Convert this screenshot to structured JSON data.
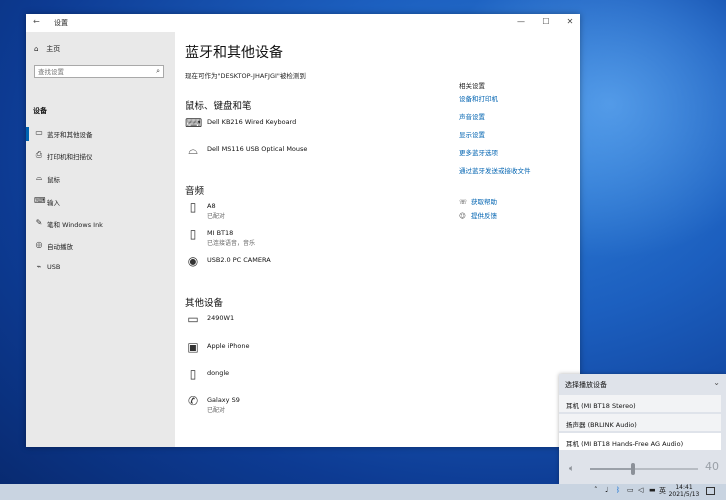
{
  "window": {
    "title": "设置",
    "back_glyph": "←",
    "minimize_glyph": "—",
    "maximize_glyph": "☐",
    "close_glyph": "✕"
  },
  "sidebar": {
    "home": "主页",
    "search_placeholder": "查找设置",
    "section": "设备",
    "items": [
      {
        "label": "蓝牙和其他设备",
        "icon": "bluetooth-devices-icon",
        "active": true
      },
      {
        "label": "打印机和扫描仪",
        "icon": "printer-icon"
      },
      {
        "label": "鼠标",
        "icon": "mouse-icon"
      },
      {
        "label": "输入",
        "icon": "keyboard-icon"
      },
      {
        "label": "笔和 Windows Ink",
        "icon": "pen-icon"
      },
      {
        "label": "自动播放",
        "icon": "autoplay-icon"
      },
      {
        "label": "USB",
        "icon": "usb-icon"
      }
    ]
  },
  "main": {
    "title": "蓝牙和其他设备",
    "discoverable": "现在可作为\"DESKTOP-JHAFJGI\"被检测到",
    "sections": [
      {
        "heading": "鼠标、键盘和笔",
        "devices": [
          {
            "name": "Dell KB216 Wired Keyboard",
            "status": "",
            "icon": "keyboard-icon"
          },
          {
            "name": "Dell MS116 USB Optical Mouse",
            "status": "",
            "icon": "mouse-icon"
          }
        ]
      },
      {
        "heading": "音频",
        "devices": [
          {
            "name": "A8",
            "status": "已配对",
            "icon": "phone-icon"
          },
          {
            "name": "MI BT18",
            "status": "已连接语音，音乐",
            "icon": "phone-icon"
          },
          {
            "name": "USB2.0 PC CAMERA",
            "status": "",
            "icon": "webcam-icon"
          }
        ]
      },
      {
        "heading": "其他设备",
        "devices": [
          {
            "name": "2490W1",
            "status": "",
            "icon": "monitor-icon"
          },
          {
            "name": "Apple iPhone",
            "status": "",
            "icon": "phone-pc-icon"
          },
          {
            "name": "dongle",
            "status": "",
            "icon": "phone-icon"
          },
          {
            "name": "Galaxy S9",
            "status": "已配对",
            "icon": "handset-icon"
          }
        ]
      }
    ]
  },
  "related": {
    "heading": "相关设置",
    "links": [
      "设备和打印机",
      "声音设置",
      "显示设置",
      "更多蓝牙选项",
      "通过蓝牙发送或接收文件"
    ],
    "help": [
      {
        "label": "获取帮助",
        "icon": "help-chat-icon"
      },
      {
        "label": "提供反馈",
        "icon": "feedback-icon"
      }
    ]
  },
  "flyout": {
    "heading": "选择播放设备",
    "options": [
      {
        "label": "耳机 (MI BT18 Stereo)",
        "selected": false
      },
      {
        "label": "扬声器 (BRLINK Audio)",
        "selected": false
      },
      {
        "label": "耳机 (MI BT18 Hands-Free AG Audio)",
        "selected": true
      }
    ],
    "volume": 40,
    "volume_max": 100
  },
  "taskbar": {
    "ime": "英",
    "time": "14:41",
    "date": "2021/5/13"
  }
}
